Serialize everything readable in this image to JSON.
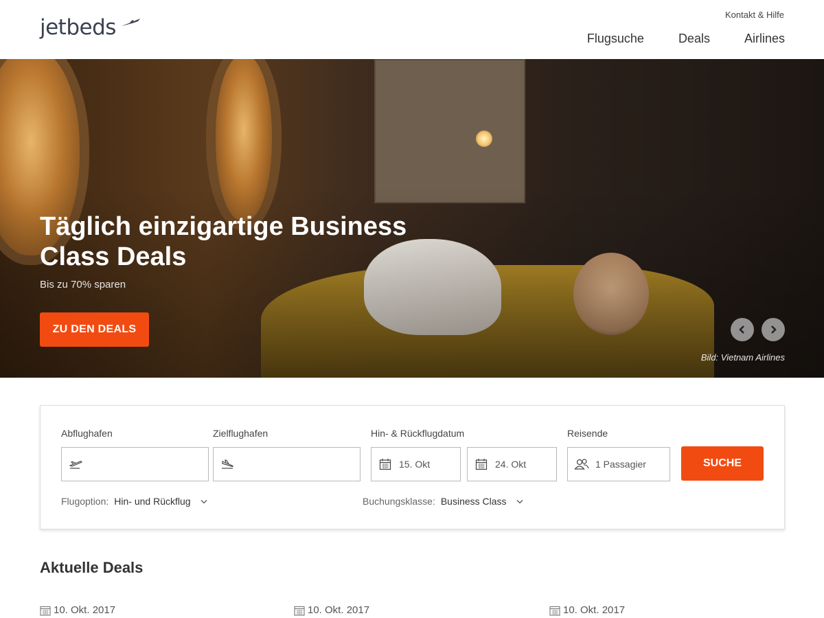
{
  "header": {
    "logo": "jetbeds",
    "top_link": "Kontakt & Hilfe",
    "nav": [
      {
        "label": "Flugsuche"
      },
      {
        "label": "Deals"
      },
      {
        "label": "Airlines"
      }
    ]
  },
  "hero": {
    "title": "Täglich einzigartige Business Class Deals",
    "subtitle": "Bis zu 70% sparen",
    "cta": "ZU DEN DEALS",
    "caption": "Bild: Vietnam Airlines",
    "prev_icon": "chevron-left-icon",
    "next_icon": "chevron-right-icon"
  },
  "search": {
    "departure_label": "Abflughafen",
    "destination_label": "Zielflughafen",
    "dates_label": "Hin- & Rückflugdatum",
    "travelers_label": "Reisende",
    "outbound_date": "15. Okt",
    "return_date": "24. Okt",
    "passengers": "1 Passagier",
    "search_button": "SUCHE",
    "flight_option_label": "Flugoption:",
    "flight_option_value": "Hin- und Rückflug",
    "class_label": "Buchungsklasse:",
    "class_value": "Business Class"
  },
  "deals": {
    "title": "Aktuelle Deals",
    "items": [
      {
        "date": "10. Okt. 2017"
      },
      {
        "date": "10. Okt. 2017"
      },
      {
        "date": "10. Okt. 2017"
      }
    ]
  },
  "colors": {
    "accent": "#f24b12",
    "text": "#333333"
  }
}
